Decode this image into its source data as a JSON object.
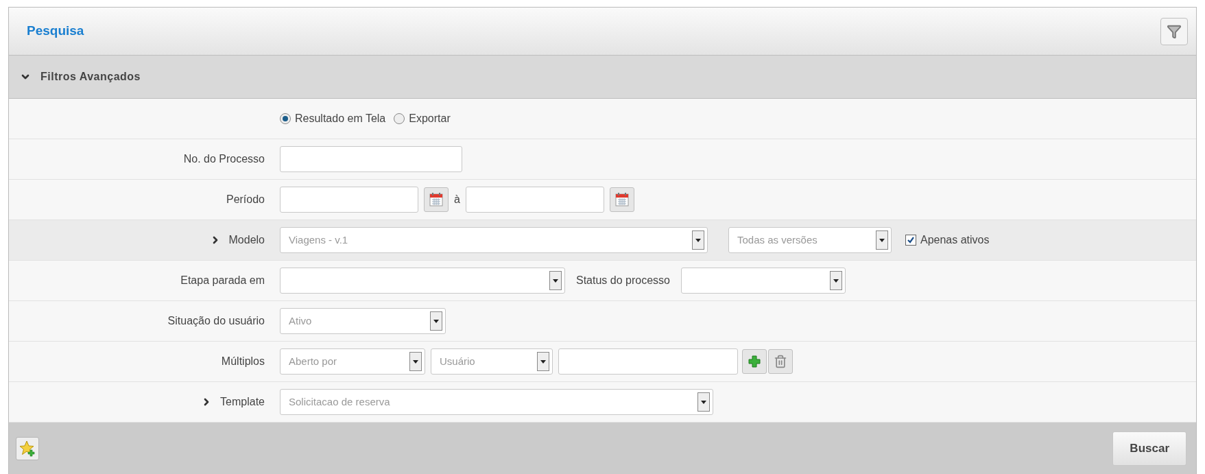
{
  "panel": {
    "title": "Pesquisa"
  },
  "section": {
    "title": "Filtros Avançados",
    "expanded": true
  },
  "output_options": [
    {
      "label": "Resultado em Tela",
      "selected": true
    },
    {
      "label": "Exportar",
      "selected": false
    }
  ],
  "process_number": {
    "label": "No. do Processo"
  },
  "period": {
    "label": "Período",
    "separator": "à"
  },
  "model": {
    "label": "Modelo",
    "expanded": false,
    "highlighted": true,
    "value": "Viagens - v.1",
    "version": "Todas as versões",
    "only_active": {
      "label": "Apenas ativos",
      "checked": true
    }
  },
  "stage": {
    "label": "Etapa parada em",
    "status_label": "Status do processo"
  },
  "user_situation": {
    "label": "Situação do usuário",
    "value": "Ativo"
  },
  "multiple": {
    "label": "Múltiplos",
    "field": "Aberto por",
    "user": "Usuário"
  },
  "template": {
    "label": "Template",
    "expanded": false,
    "value": "Solicitacao de reserva"
  },
  "search_button": "Buscar"
}
